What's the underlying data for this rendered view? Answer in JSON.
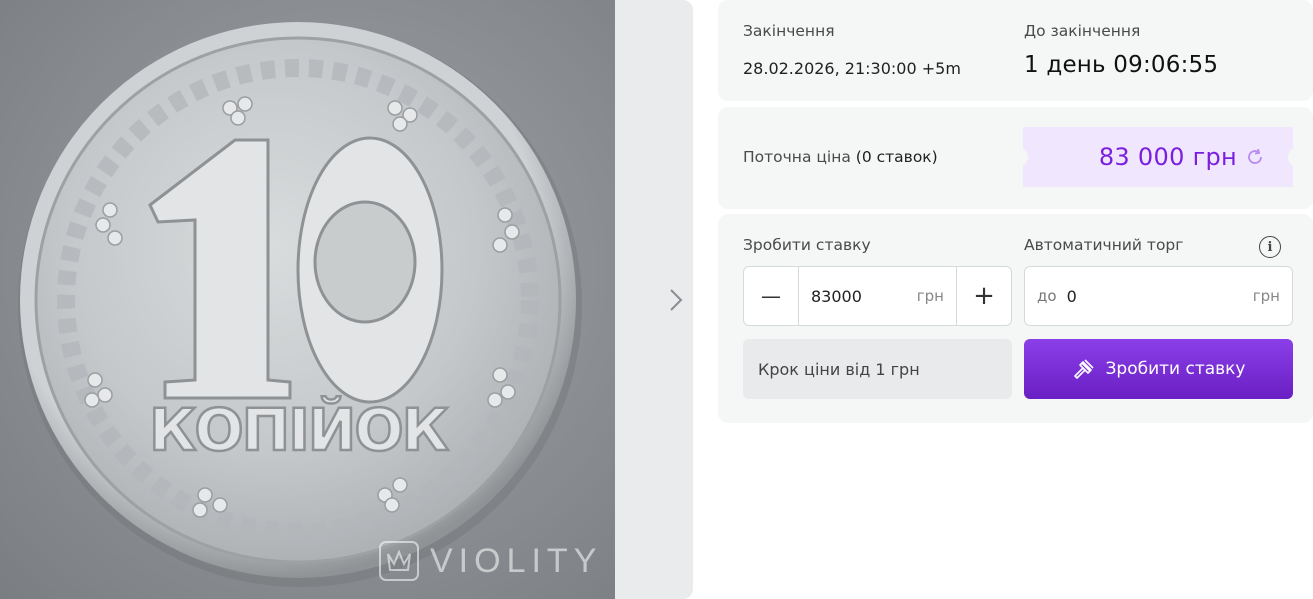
{
  "gallery": {
    "coin": {
      "denomination": "10",
      "word": "КОПІЙОК"
    },
    "watermark": "VIOLITY"
  },
  "auction": {
    "end_label": "Закінчення",
    "end_value": "28.02.2026, 21:30:00 +5m",
    "remaining_label": "До закінчення",
    "remaining_value": "1 день 09:06:55"
  },
  "price": {
    "label": "Поточна ціна",
    "bids_count": "(0 ставок)",
    "value": "83 000 грн"
  },
  "bid": {
    "make_bid_label": "Зробити ставку",
    "decrement_symbol": "—",
    "increment_symbol": "+",
    "amount": "83000",
    "currency": "грн",
    "auto_label": "Автоматичний торг",
    "auto_prefix": "до",
    "auto_amount": "0",
    "auto_currency": "грн",
    "step_note": "Крок ціни від 1 грн",
    "submit_label": "Зробити ставку"
  },
  "colors": {
    "accent": "#7a1fe0",
    "price_badge_bg": "#f0e6fd",
    "panel_bg": "#f5f6f6"
  }
}
